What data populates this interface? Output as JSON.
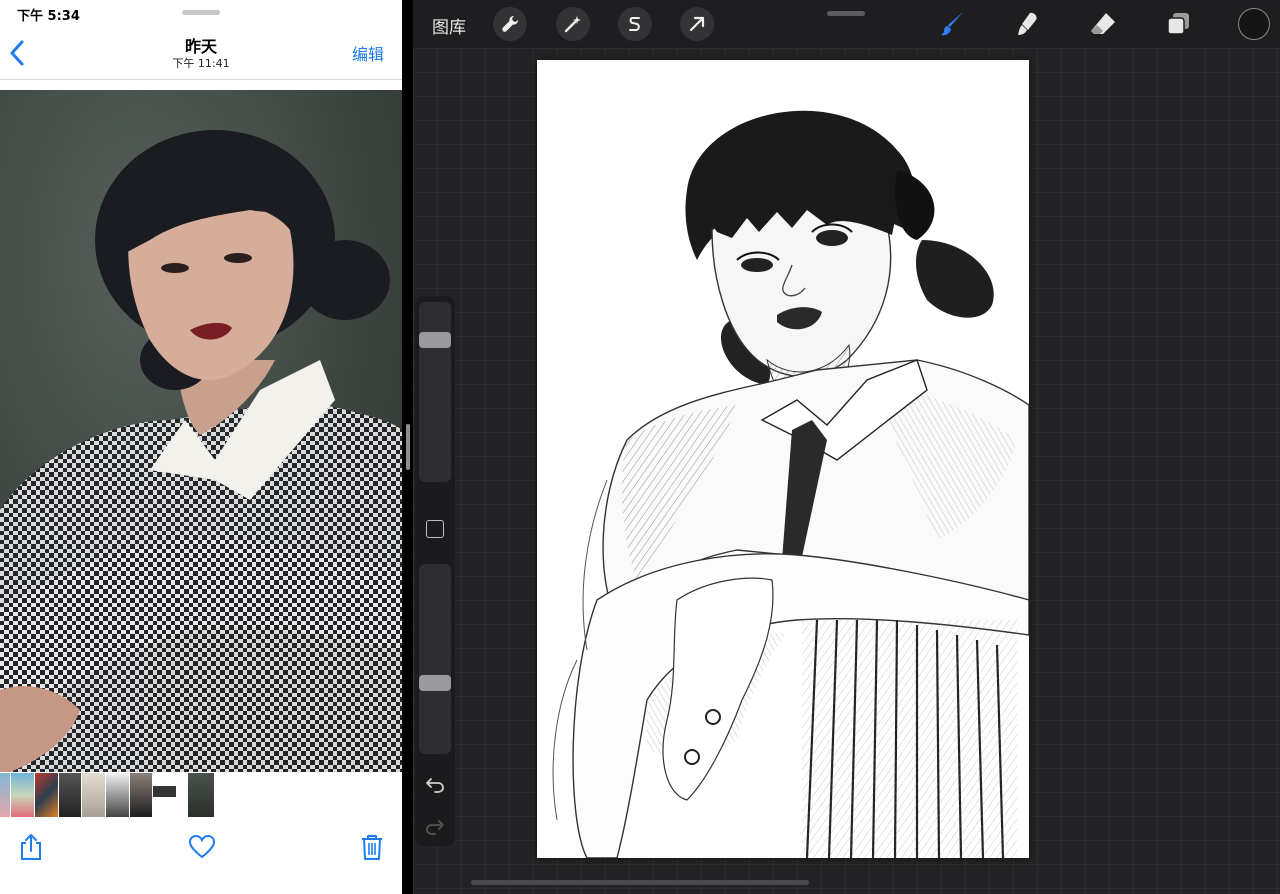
{
  "photos": {
    "status_time": "下午 5:34",
    "nav": {
      "back_icon": "chevron-left-icon",
      "title": "昨天",
      "subtitle": "下午 11:41",
      "edit_label": "编辑"
    },
    "thumbnail_count": 9,
    "toolbar": {
      "share_icon": "share-icon",
      "favorite_icon": "heart-icon",
      "delete_icon": "trash-icon"
    }
  },
  "procreate": {
    "gallery_label": "图库",
    "tools_left": [
      "wrench-icon",
      "magic-wand-icon",
      "selection-icon",
      "transform-arrow-icon"
    ],
    "tools_right": [
      "brush-icon",
      "smudge-icon",
      "eraser-icon",
      "layers-icon"
    ],
    "active_tool": "brush-icon",
    "current_color": "#161616",
    "accent_color": "#2f7ff2",
    "brush_size_level": 0.18,
    "opacity_level": 0.64
  }
}
